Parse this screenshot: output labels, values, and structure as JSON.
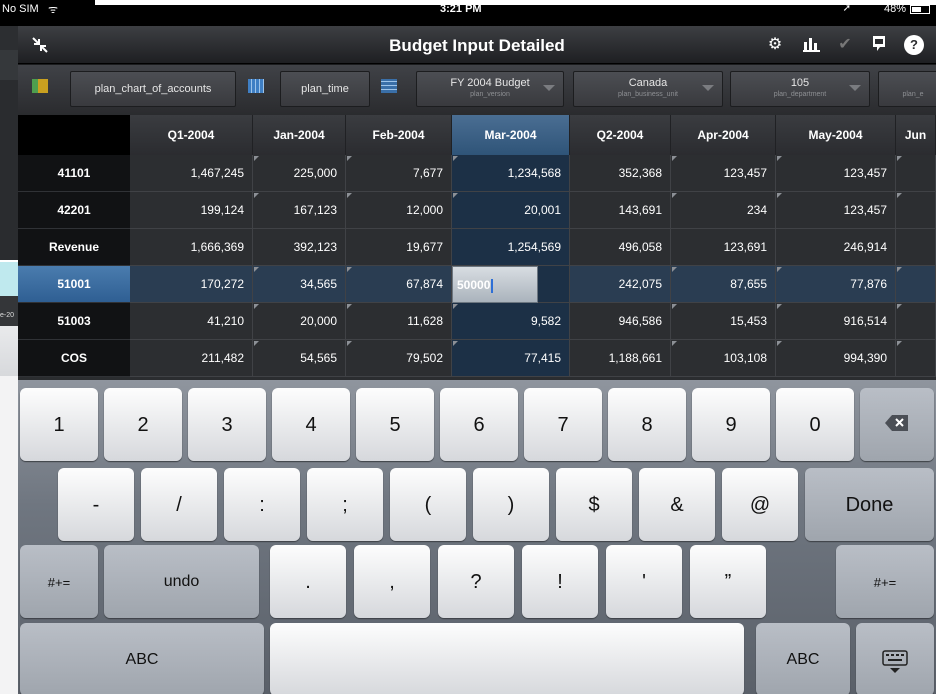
{
  "statusbar": {
    "carrier": "No SIM",
    "wifi": "ᯤ",
    "time": "3:21 PM",
    "battery": "48%"
  },
  "underlying": {
    "label": "e-20"
  },
  "titlebar": {
    "title": "Budget Input Detailed"
  },
  "pov": [
    {
      "name": "plan_chart_of_accounts"
    },
    {
      "name": "plan_time"
    },
    {
      "value": "FY 2004 Budget",
      "sub": "plan_version"
    },
    {
      "value": "Canada",
      "sub": "plan_business_unit"
    },
    {
      "value": "105",
      "sub": "plan_department"
    },
    {
      "value": "",
      "sub": "plan_e"
    }
  ],
  "grid": {
    "columns": [
      "Q1-2004",
      "Jan-2004",
      "Feb-2004",
      "Mar-2004",
      "Q2-2004",
      "Apr-2004",
      "May-2004",
      "Jun"
    ],
    "rows": [
      {
        "label": "41101",
        "cells": [
          "1,467,245",
          "225,000",
          "7,677",
          "1,234,568",
          "352,368",
          "123,457",
          "123,457",
          ""
        ]
      },
      {
        "label": "42201",
        "cells": [
          "199,124",
          "167,123",
          "12,000",
          "20,001",
          "143,691",
          "234",
          "123,457",
          ""
        ]
      },
      {
        "label": "Revenue",
        "cells": [
          "1,666,369",
          "392,123",
          "19,677",
          "1,254,569",
          "496,058",
          "123,691",
          "246,914",
          ""
        ]
      },
      {
        "label": "51001",
        "cells": [
          "170,272",
          "34,565",
          "67,874",
          "",
          "242,075",
          "87,655",
          "77,876",
          ""
        ]
      },
      {
        "label": "51003",
        "cells": [
          "41,210",
          "20,000",
          "11,628",
          "9,582",
          "946,586",
          "15,453",
          "916,514",
          ""
        ]
      },
      {
        "label": "COS",
        "cells": [
          "211,482",
          "54,565",
          "79,502",
          "77,415",
          "1,188,661",
          "103,108",
          "994,390",
          ""
        ]
      }
    ],
    "edit_value": "50000"
  },
  "keyboard": {
    "row1": [
      "1",
      "2",
      "3",
      "4",
      "5",
      "6",
      "7",
      "8",
      "9",
      "0"
    ],
    "row2": [
      "-",
      "/",
      ":",
      ";",
      "(",
      ")",
      "$",
      "&",
      "@"
    ],
    "done": "Done",
    "row3_left": "#+=",
    "undo": "undo",
    "row3": [
      ".",
      ",",
      "?",
      "!",
      "'",
      "”"
    ],
    "row3_right": "#+=",
    "abc": "ABC"
  }
}
